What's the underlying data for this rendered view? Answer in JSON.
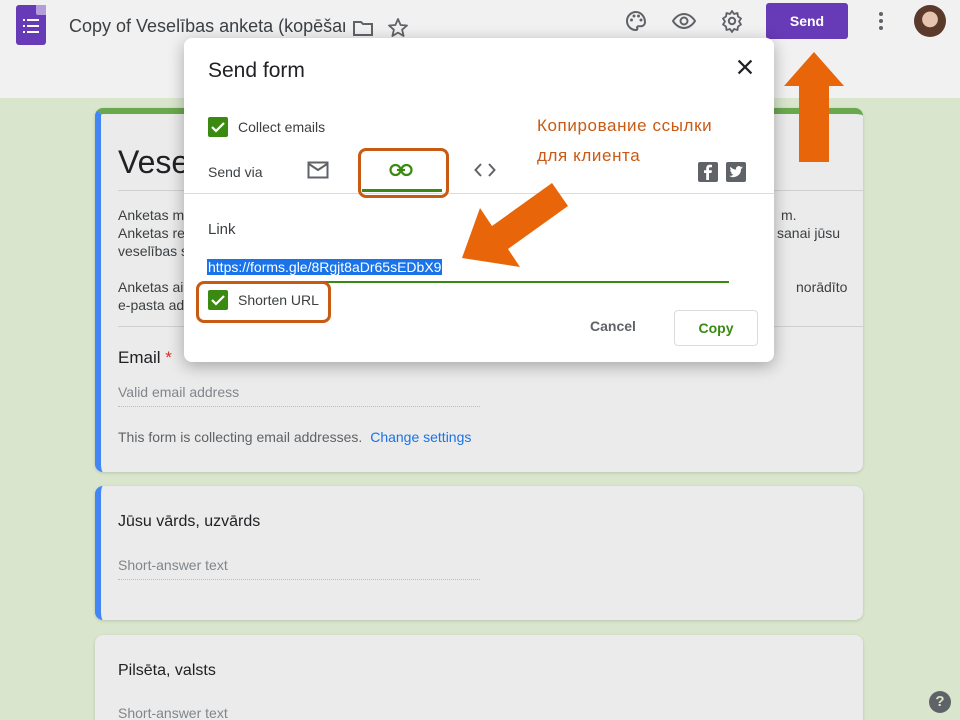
{
  "header": {
    "doc_title": "Copy of Veselības anketa (kopēšana)",
    "send_label": "Send"
  },
  "form": {
    "title_fragment": "Vese",
    "description_lines": [
      "Anketas m",
      "Anketas re",
      "veselības s",
      "Anketas ai",
      "e-pasta ad"
    ],
    "description_right": [
      "m.",
      "sanai jūsu",
      "norādīto"
    ],
    "email_question": {
      "label": "Email",
      "required_mark": "*",
      "placeholder": "Valid email address",
      "collecting_note": "This form is collecting email addresses.",
      "change_settings": "Change settings"
    },
    "questions": [
      {
        "title": "Jūsu vārds, uzvārds",
        "hint": "Short-answer text"
      },
      {
        "title": "Pilsēta, valsts",
        "hint": "Short-answer text"
      }
    ]
  },
  "dialog": {
    "title": "Send form",
    "collect_emails_label": "Collect emails",
    "send_via_label": "Send via",
    "link_label": "Link",
    "link_value": "https://forms.gle/8Rgjt8aDr65sEDbX9",
    "shorten_url_label": "Shorten URL",
    "cancel_label": "Cancel",
    "copy_label": "Copy"
  },
  "annotation": {
    "line1": "Копирование ссылки",
    "line2": "для клиента"
  },
  "help_glyph": "?",
  "colors": {
    "accent": "#673ab7",
    "green": "#3a8a12",
    "annotation": "#c85a13",
    "blue_bar": "#4285f4",
    "selection": "#1a73e8"
  },
  "icons": {
    "palette": "palette-icon",
    "preview": "eye-icon",
    "settings": "gear-icon",
    "more": "more-vert-icon",
    "folder": "folder-icon",
    "star": "star-icon",
    "email": "mail-icon",
    "link": "link-icon",
    "embed": "code-icon",
    "facebook": "facebook-icon",
    "twitter": "twitter-icon",
    "close": "close-icon",
    "help": "help-icon"
  }
}
